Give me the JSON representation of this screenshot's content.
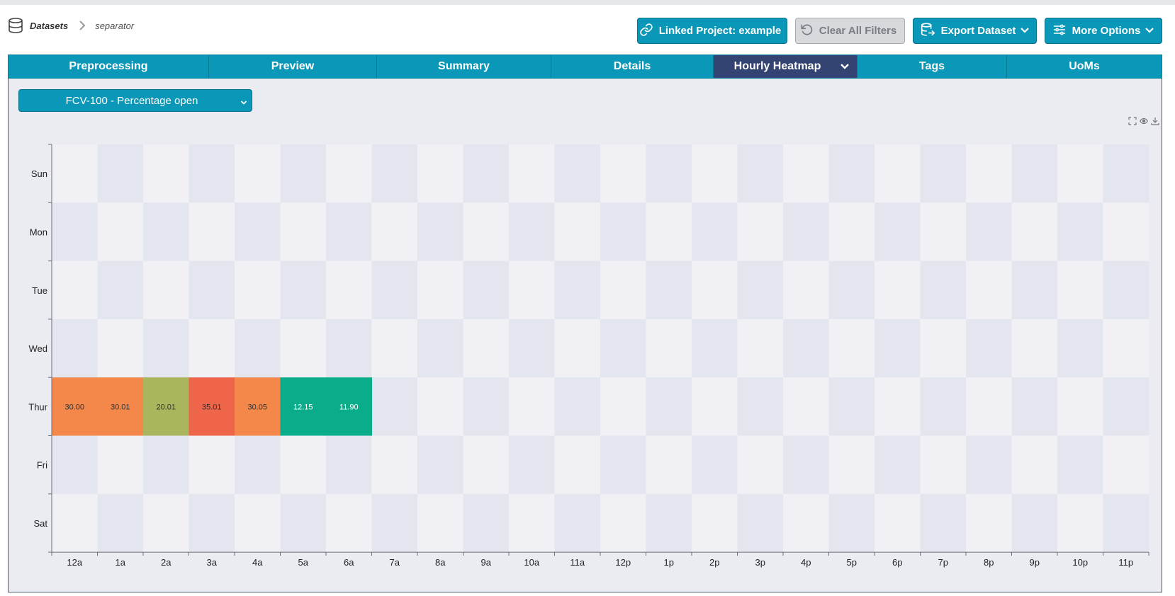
{
  "breadcrumb": {
    "icon": "database-icon",
    "root": "Datasets",
    "current": "separator"
  },
  "toolbar": {
    "linked_project": "Linked Project: example",
    "clear_filters": "Clear All Filters",
    "export_dataset": "Export Dataset",
    "more_options": "More Options"
  },
  "tabs": [
    {
      "label": "Preprocessing"
    },
    {
      "label": "Preview"
    },
    {
      "label": "Summary"
    },
    {
      "label": "Details"
    },
    {
      "label": "Hourly Heatmap",
      "active": true
    },
    {
      "label": "Tags"
    },
    {
      "label": "UoMs"
    }
  ],
  "selector": {
    "value": "FCV-100 - Percentage open"
  },
  "colors": {
    "brand": "#0a97b8",
    "active_tab": "#334372",
    "cell_bg_a": "#f1f1f5",
    "cell_bg_b": "#e3e6ef"
  },
  "chart_data": {
    "type": "heatmap",
    "x": [
      "12a",
      "1a",
      "2a",
      "3a",
      "4a",
      "5a",
      "6a",
      "7a",
      "8a",
      "9a",
      "10a",
      "11a",
      "12p",
      "1p",
      "2p",
      "3p",
      "4p",
      "5p",
      "6p",
      "7p",
      "8p",
      "9p",
      "10p",
      "11p"
    ],
    "y": [
      "Sun",
      "Mon",
      "Tue",
      "Wed",
      "Thur",
      "Fri",
      "Sat"
    ],
    "cells": [
      {
        "day": "Thur",
        "hour": "12a",
        "value": 30.0,
        "label": "30.00",
        "color": "#f3884a",
        "text_color": "#333333"
      },
      {
        "day": "Thur",
        "hour": "1a",
        "value": 30.01,
        "label": "30.01",
        "color": "#f3884a",
        "text_color": "#333333"
      },
      {
        "day": "Thur",
        "hour": "2a",
        "value": 20.01,
        "label": "20.01",
        "color": "#abb55d",
        "text_color": "#333333"
      },
      {
        "day": "Thur",
        "hour": "3a",
        "value": 35.01,
        "label": "35.01",
        "color": "#ef654a",
        "text_color": "#333333"
      },
      {
        "day": "Thur",
        "hour": "4a",
        "value": 30.05,
        "label": "30.05",
        "color": "#f3884a",
        "text_color": "#333333"
      },
      {
        "day": "Thur",
        "hour": "5a",
        "value": 12.15,
        "label": "12.15",
        "color": "#09ad8a",
        "text_color": "#ffffff"
      },
      {
        "day": "Thur",
        "hour": "6a",
        "value": 11.9,
        "label": "11.90",
        "color": "#09ad8a",
        "text_color": "#ffffff"
      }
    ]
  }
}
